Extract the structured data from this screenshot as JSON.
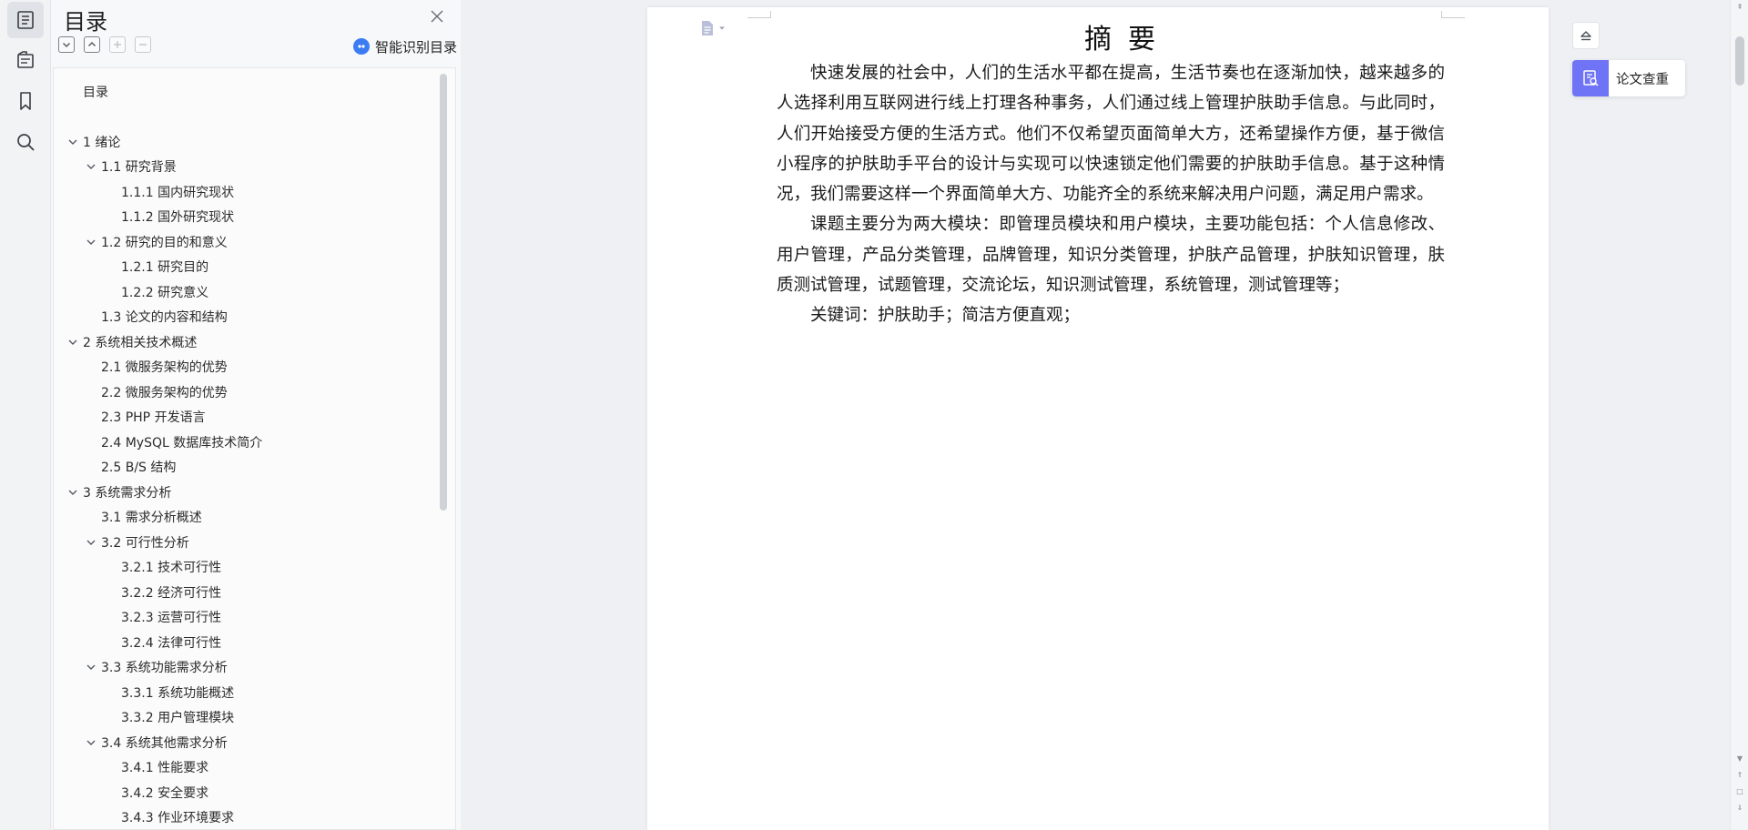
{
  "rail": {
    "items": [
      {
        "icon": "toc-icon"
      },
      {
        "icon": "navigation-icon"
      },
      {
        "icon": "bookmark-icon"
      },
      {
        "icon": "search-icon"
      }
    ]
  },
  "toc": {
    "title": "目录",
    "smart_label": "智能识别目录",
    "items": [
      {
        "label": "目录",
        "level": 0,
        "expandable": false
      },
      {
        "label": "1 绪论",
        "level": 0,
        "expandable": true
      },
      {
        "label": "1.1  研究背景",
        "level": 1,
        "expandable": true
      },
      {
        "label": "1.1.1 国内研究现状",
        "level": 2,
        "expandable": false
      },
      {
        "label": "1.1.2 国外研究现状",
        "level": 2,
        "expandable": false
      },
      {
        "label": "1.2 研究的目的和意义",
        "level": 1,
        "expandable": true
      },
      {
        "label": "1.2.1 研究目的",
        "level": 2,
        "expandable": false
      },
      {
        "label": "1.2.2  研究意义",
        "level": 2,
        "expandable": false
      },
      {
        "label": "1.3  论文的内容和结构",
        "level": 1,
        "expandable": false
      },
      {
        "label": "2 系统相关技术概述",
        "level": 0,
        "expandable": true
      },
      {
        "label": "2.1  微服务架构的优势",
        "level": 1,
        "expandable": false
      },
      {
        "label": "2.2 微服务架构的优势",
        "level": 1,
        "expandable": false
      },
      {
        "label": "2.3 PHP 开发语言",
        "level": 1,
        "expandable": false
      },
      {
        "label": "2.4 MySQL 数据库技术简介",
        "level": 1,
        "expandable": false
      },
      {
        "label": "2.5 B/S 结构",
        "level": 1,
        "expandable": false
      },
      {
        "label": "3 系统需求分析",
        "level": 0,
        "expandable": true
      },
      {
        "label": "3.1 需求分析概述",
        "level": 1,
        "expandable": false
      },
      {
        "label": "3.2 可行性分析",
        "level": 1,
        "expandable": true
      },
      {
        "label": "3.2.1 技术可行性",
        "level": 2,
        "expandable": false
      },
      {
        "label": "3.2.2 经济可行性",
        "level": 2,
        "expandable": false
      },
      {
        "label": "3.2.3 运营可行性",
        "level": 2,
        "expandable": false
      },
      {
        "label": "3.2.4 法律可行性",
        "level": 2,
        "expandable": false
      },
      {
        "label": "3.3 系统功能需求分析",
        "level": 1,
        "expandable": true
      },
      {
        "label": "3.3.1 系统功能概述",
        "level": 2,
        "expandable": false
      },
      {
        "label": "3.3.2 用户管理模块",
        "level": 2,
        "expandable": false
      },
      {
        "label": "3.4 系统其他需求分析",
        "level": 1,
        "expandable": true
      },
      {
        "label": "3.4.1 性能要求",
        "level": 2,
        "expandable": false
      },
      {
        "label": "3.4.2 安全要求",
        "level": 2,
        "expandable": false
      },
      {
        "label": "3.4.3 作业环境要求",
        "level": 2,
        "expandable": false
      }
    ]
  },
  "document": {
    "heading": "摘要",
    "paragraphs": [
      "快速发展的社会中，人们的生活水平都在提高，生活节奏也在逐渐加快，越来越多的人选择利用互联网进行线上打理各种事务，人们通过线上管理护肤助手信息。与此同时，人们开始接受方便的生活方式。他们不仅希望页面简单大方，还希望操作方便，基于微信小程序的护肤助手平台的设计与实现可以快速锁定他们需要的护肤助手信息。基于这种情况，我们需要这样一个界面简单大方、功能齐全的系统来解决用户问题，满足用户需求。",
      "课题主要分为两大模块：即管理员模块和用户模块，主要功能包括：个人信息修改、用户管理，产品分类管理，品牌管理，知识分类管理，护肤产品管理，护肤知识管理，肤质测试管理，试题管理，交流论坛，知识测试管理，系统管理，测试管理等；",
      "关键词：护肤助手；简洁方便直观；"
    ]
  },
  "float": {
    "check_label": "论文查重"
  },
  "colors": {
    "accent": "#3b7cf4",
    "check_accent": "#6f73f6"
  }
}
